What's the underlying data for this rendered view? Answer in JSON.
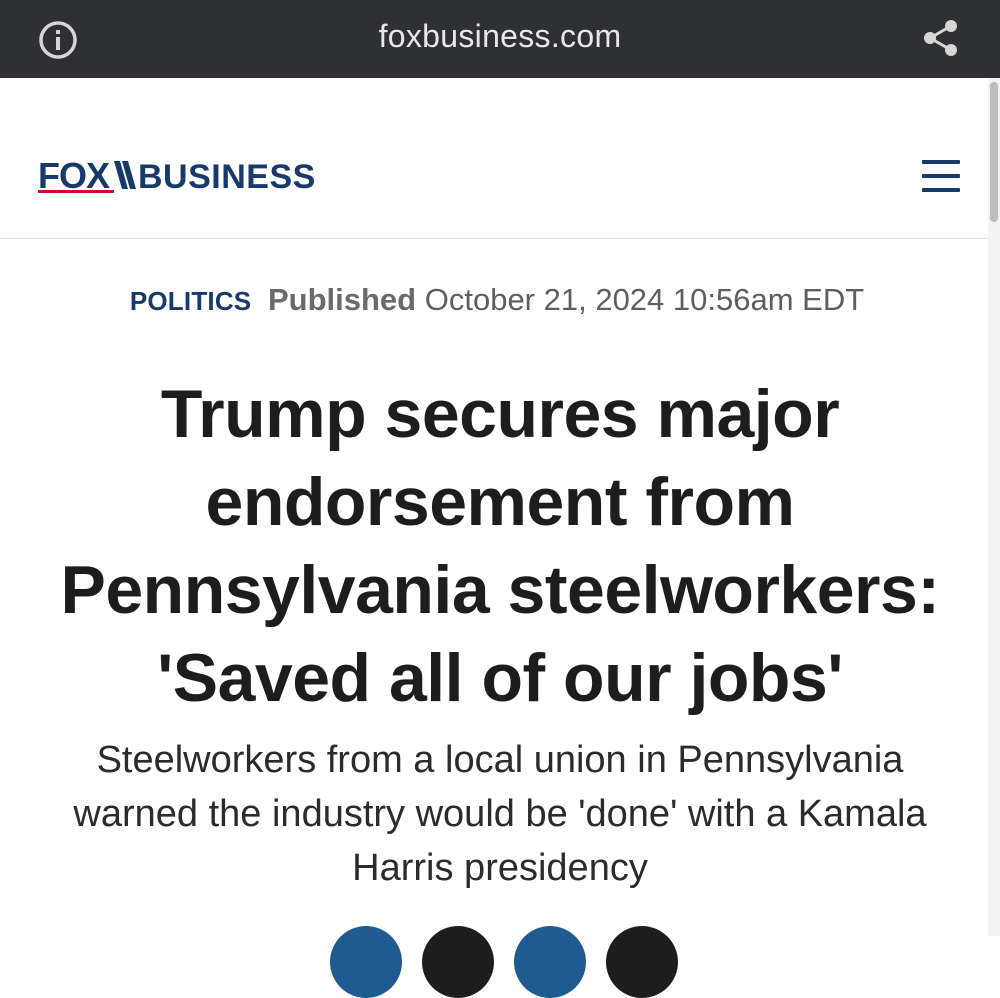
{
  "browser": {
    "url": "foxbusiness.com",
    "info_icon": "info-icon",
    "share_icon": "share-icon"
  },
  "header": {
    "logo_text": "FOX BUSINESS",
    "logo_left": "FOX",
    "logo_right": "BUSINESS",
    "menu_icon": "hamburger-menu-icon",
    "brand_color": "#183a6b",
    "accent_color": "#c8102e"
  },
  "article": {
    "category": "POLITICS",
    "published_label": "Published",
    "published_date": "October 21, 2024 10:56am EDT",
    "headline": "Trump secures major endorsement from Pennsylvania steelworkers: 'Saved all of our jobs'",
    "subheadline": "Steelworkers from a local union in Pennsylvania warned the industry would be 'done' with a Kamala Harris presidency"
  },
  "share_buttons": {
    "colors": [
      "#1f5a91",
      "#1d1d1d",
      "#1f5a91",
      "#1d1d1d"
    ]
  }
}
